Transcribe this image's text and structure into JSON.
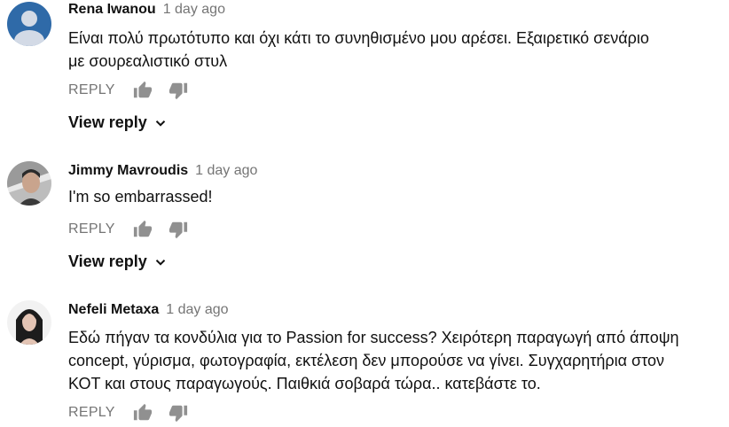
{
  "comments": [
    {
      "author": "Rena Iwanou",
      "time": "1 day ago",
      "text_lines": [
        "Είναι πολύ πρωτότυπο και όχι κάτι το συνηθισμένο μου αρέσει. Εξαιρετικό σενάριο",
        "με σουρεαλιστικό στυλ"
      ],
      "reply_label": "REPLY",
      "view_reply_label": "View reply",
      "avatar": "default-user-icon"
    },
    {
      "author": "Jimmy Mavroudis",
      "time": "1 day ago",
      "text_lines": [
        "I'm so embarrassed!"
      ],
      "reply_label": "REPLY",
      "view_reply_label": "View reply",
      "avatar": "profile-photo"
    },
    {
      "author": "Nefeli Metaxa",
      "time": "1 day ago",
      "text_lines": [
        "Εδώ πήγαν τα κονδύλια για το Passion for success? Χειρότερη παραγωγή από άποψη",
        "concept, γύρισμα, φωτογραφία, εκτέλεση δεν μπορούσε να γίνει. Συγχαρητήρια στον",
        "ΚΟΤ και στους παραγωγούς. Παιθκιά σοβαρά τώρα.. κατεβάστε το."
      ],
      "reply_label": "REPLY",
      "avatar": "profile-photo"
    }
  ],
  "icons": {
    "like": "thumbs-up-icon",
    "dislike": "thumbs-down-icon",
    "expand": "chevron-down-icon"
  },
  "colors": {
    "text": "#111111",
    "meta": "#757575",
    "icon": "#909090",
    "default_avatar_bg": "#2f6aa8"
  }
}
